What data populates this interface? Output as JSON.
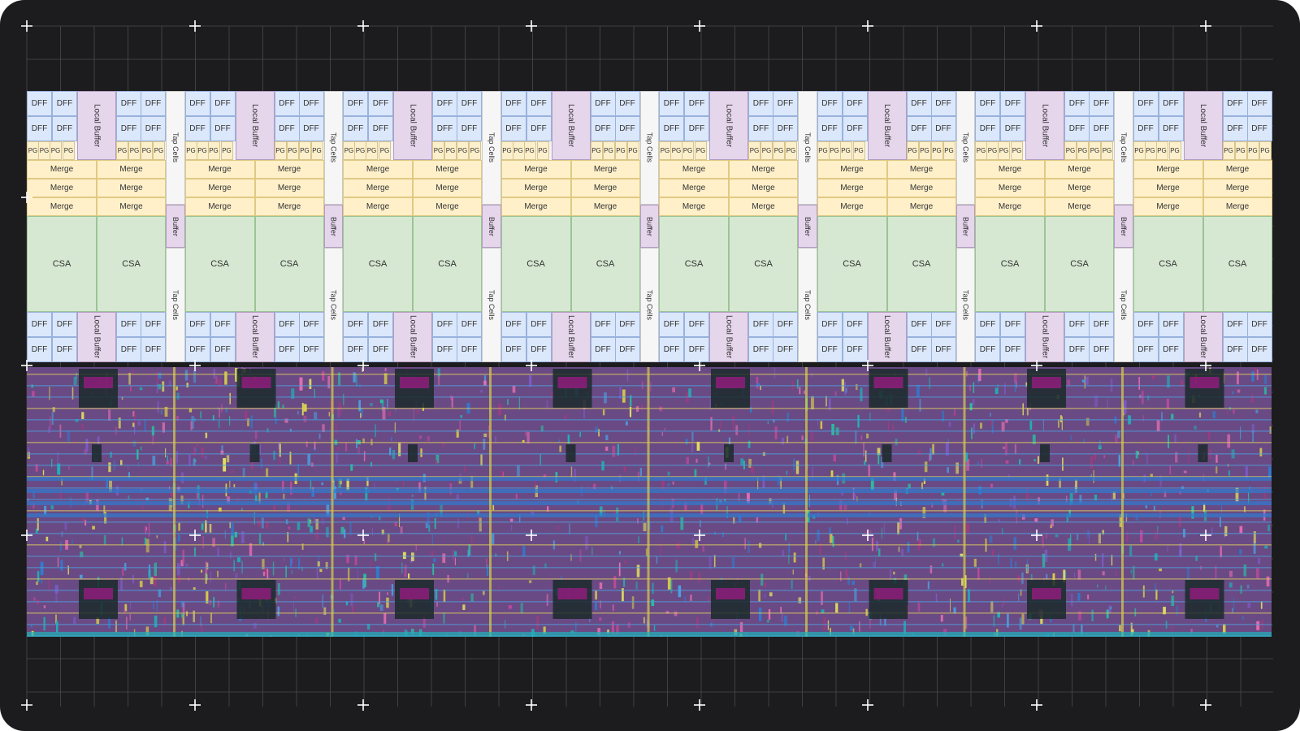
{
  "labels": {
    "dff": "DFF",
    "local_buffer": "Local Buffer",
    "pg": "PG",
    "merge": "Merge",
    "csa": "CSA",
    "tap_cells": "Tap Cells",
    "buffer": "Buffer"
  },
  "columns": 8,
  "colors": {
    "background": "#1c1c1e",
    "grid": "#4a4a4d",
    "crosshair": "#ffffff",
    "dff": "#dbe7fb",
    "local_buffer": "#e6d6ec",
    "pg": "#fcefcb",
    "merge": "#fff0c9",
    "csa": "#d6e8d2",
    "tap_cells": "#f6f6f6",
    "layout_magenta": "#c04a9a",
    "layout_blue": "#2f7bd0",
    "layout_yellow": "#d8cf4a"
  }
}
